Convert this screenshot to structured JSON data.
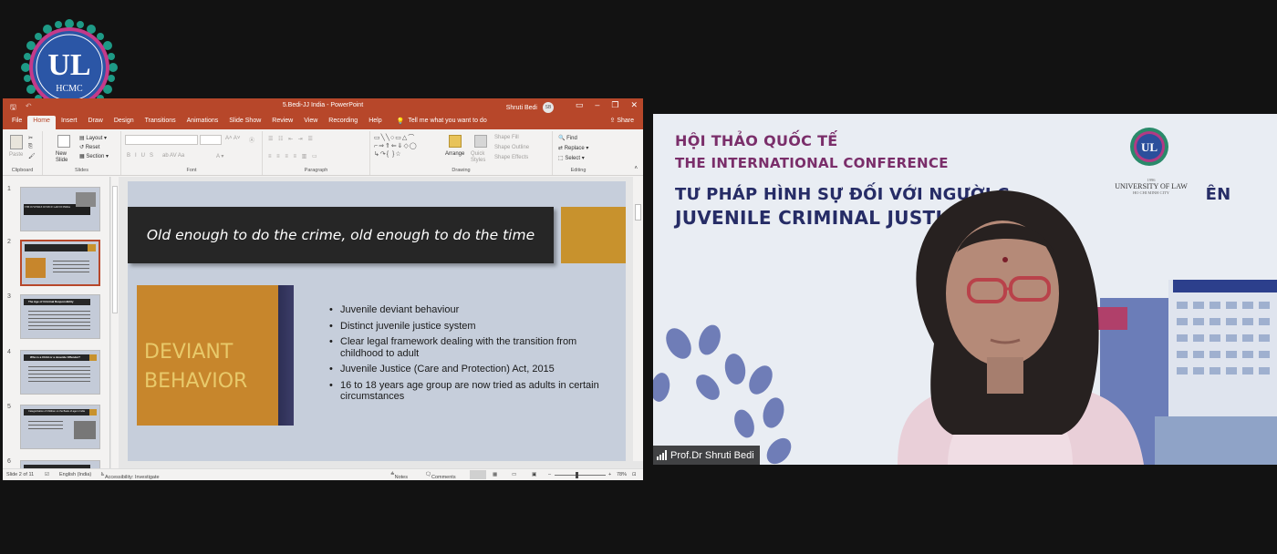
{
  "logo": {
    "text": "HCMC"
  },
  "ppt": {
    "doc_title": "5.Bedi-JJ India  -  PowerPoint",
    "user_name": "Shruti Bedi",
    "user_initials": "SB",
    "tabs": [
      "File",
      "Home",
      "Insert",
      "Draw",
      "Design",
      "Transitions",
      "Animations",
      "Slide Show",
      "Review",
      "View",
      "Recording",
      "Help"
    ],
    "active_tab": "Home",
    "tell_me": "Tell me what you want to do",
    "share": "Share",
    "ribbon": {
      "paste": "Paste",
      "new_slide": "New Slide",
      "layout": "Layout",
      "reset": "Reset",
      "section": "Section",
      "arrange": "Arrange",
      "quick_styles": "Quick Styles",
      "shape_fill": "Shape Fill",
      "shape_outline": "Shape Outline",
      "shape_effects": "Shape Effects",
      "find": "Find",
      "replace": "Replace",
      "select": "Select",
      "groups": [
        "Clipboard",
        "Slides",
        "Font",
        "Paragraph",
        "Drawing",
        "Editing"
      ]
    },
    "thumbnails": [
      "1",
      "2",
      "3",
      "4",
      "5",
      "6"
    ],
    "thumb_titles": {
      "t1": "THE JUVENILE JUSTICE LAW IN INDIA",
      "t2": "Old enough to do the crime, old enough to do the time",
      "t3": "The Age of Criminal Responsibility",
      "t4": "Who is a Child or a Juvenile Offender?",
      "t5": "Categorization of Children on the Basis of age in India"
    },
    "slide": {
      "title": "Old enough to do the crime, old enough to do the time",
      "block_line1": "DEVIANT",
      "block_line2": "BEHAVIOR",
      "bullets": [
        "Juvenile deviant behaviour",
        "Distinct juvenile justice system",
        "Clear legal framework dealing with the transition from childhood to adult",
        "Juvenile Justice (Care and Protection) Act, 2015",
        "16 to 18 years age group are now tried as adults in certain circumstances"
      ]
    },
    "status": {
      "slide_of": "Slide 2 of 11",
      "language": "English (India)",
      "accessibility": "Accessibility: Investigate",
      "notes": "Notes",
      "comments": "Comments",
      "zoom": "78%"
    }
  },
  "video": {
    "line1": "HỘI THẢO QUỐC TẾ",
    "line2": "THE INTERNATIONAL CONFERENCE",
    "line3": "TƯ PHÁP HÌNH SỰ ĐỐI VỚI NGƯỜI C",
    "line3_tail": "ÊN",
    "line4": "JUVENILE CRIMINAL JUSTI",
    "uni_year": "1996",
    "uni_name": "UNIVERSITY OF LAW",
    "uni_city": "HO CHI MINH CITY",
    "participant": "Prof.Dr Shruti Bedi"
  },
  "colors": {
    "ppt_accent": "#b7472a",
    "slide_gold": "#c8922d",
    "conf_purple": "#7a2e6a",
    "conf_navy": "#262c66"
  }
}
